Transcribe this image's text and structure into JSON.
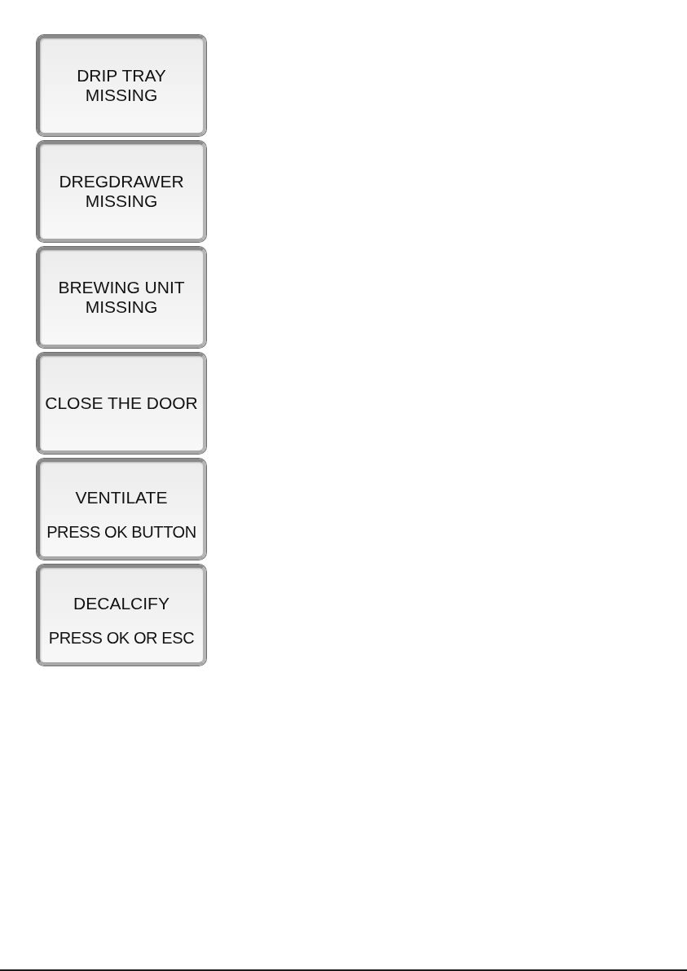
{
  "displays": [
    {
      "message": "DRIP TRAY MISSING"
    },
    {
      "message": "DREGDRAWER MISSING"
    },
    {
      "message": "BREWING UNIT MISSING"
    },
    {
      "message": "CLOSE THE DOOR"
    },
    {
      "message": "VENTILATE",
      "prompt": "PRESS OK BUTTON"
    },
    {
      "message": "DECALCIFY",
      "prompt": "PRESS OK OR ESC"
    }
  ]
}
